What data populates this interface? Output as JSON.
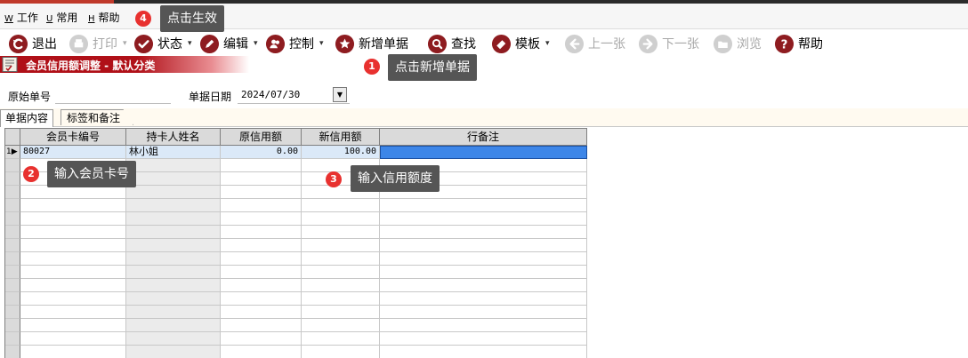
{
  "menu": [
    {
      "key": "W",
      "label": "工作"
    },
    {
      "key": "U",
      "label": "常用"
    },
    {
      "key": "H",
      "label": "帮助"
    }
  ],
  "toolbar": {
    "exit": "退出",
    "print": "打印",
    "status": "状态",
    "edit": "编辑",
    "control": "控制",
    "new_doc": "新增单据",
    "find": "查找",
    "template": "模板",
    "prev": "上一张",
    "next": "下一张",
    "browse": "浏览",
    "help": "帮助"
  },
  "panel": {
    "title": "会员信用额调整 - 默认分类"
  },
  "form": {
    "orig_no_label": "原始单号",
    "orig_no_value": "",
    "date_label": "单据日期",
    "date_value": "2024/07/30"
  },
  "tabs": [
    "单据内容",
    "标签和备注"
  ],
  "grid": {
    "columns": [
      "会员卡编号",
      "持卡人姓名",
      "原信用额",
      "新信用额",
      "行备注"
    ],
    "rows": [
      {
        "indicator": "1▶",
        "card_no": "80027",
        "holder": "林小姐",
        "old_credit": "0.00",
        "new_credit": "100.00",
        "remark": ""
      }
    ],
    "empty_rows": 15
  },
  "tips": [
    {
      "n": "4",
      "text": "点击生效"
    },
    {
      "n": "1",
      "text": "点击新增单据"
    },
    {
      "n": "2",
      "text": "输入会员卡号"
    },
    {
      "n": "3",
      "text": "输入信用额度"
    }
  ],
  "colors": {
    "title_red": "#b01018",
    "tip_bg": "#555555",
    "badge_red": "#e8312f",
    "focus_blue": "#3d86e8"
  }
}
